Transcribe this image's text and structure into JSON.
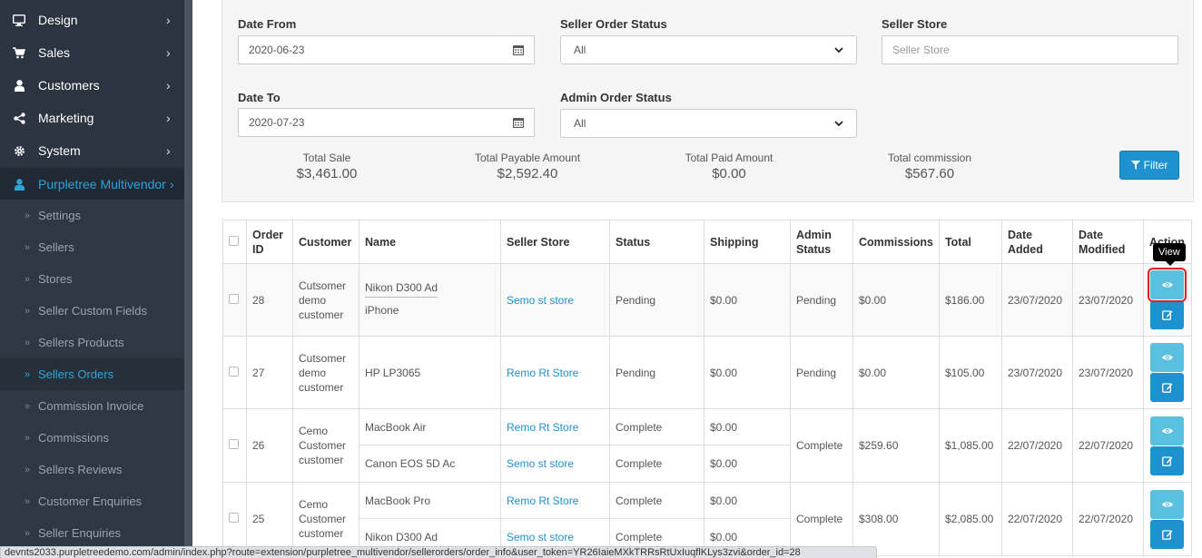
{
  "sidebar": {
    "menu": [
      {
        "label": "Design",
        "icon": "desktop-icon"
      },
      {
        "label": "Sales",
        "icon": "cart-icon"
      },
      {
        "label": "Customers",
        "icon": "user-icon"
      },
      {
        "label": "Marketing",
        "icon": "share-icon"
      },
      {
        "label": "System",
        "icon": "gear-icon"
      },
      {
        "label": "Purpletree Multivendor",
        "icon": "user-icon"
      }
    ],
    "submenu": [
      "Settings",
      "Sellers",
      "Stores",
      "Seller Custom Fields",
      "Sellers Products",
      "Sellers Orders",
      "Commission Invoice",
      "Commissions",
      "Sellers Reviews",
      "Customer Enquiries",
      "Seller Enquiries"
    ]
  },
  "filter": {
    "date_from_label": "Date From",
    "date_from_value": "2020-06-23",
    "date_to_label": "Date To",
    "date_to_value": "2020-07-23",
    "seller_status_label": "Seller Order Status",
    "seller_status_value": "All",
    "admin_status_label": "Admin Order Status",
    "admin_status_value": "All",
    "seller_store_label": "Seller Store",
    "seller_store_placeholder": "Seller Store",
    "filter_button": "Filter"
  },
  "summary": {
    "total_sale_label": "Total Sale",
    "total_sale": "$3,461.00",
    "payable_label": "Total Payable Amount",
    "payable": "$2,592.40",
    "paid_label": "Total Paid Amount",
    "paid": "$0.00",
    "commission_label": "Total commission",
    "commission": "$567.60"
  },
  "table": {
    "headers": [
      "Order ID",
      "Customer",
      "Name",
      "Seller Store",
      "Status",
      "Shipping",
      "Admin Status",
      "Commissions",
      "Total",
      "Date Added",
      "Date Modified",
      "Action"
    ],
    "rows": [
      {
        "order_id": "28",
        "customer": "Cutsomer demo customer",
        "lines": [
          {
            "name": "Nikon D300 Ad",
            "store": "Semo st store",
            "status": "Pending",
            "shipping": "$0.00"
          },
          {
            "name": "iPhone",
            "store": "",
            "status": "",
            "shipping": ""
          }
        ],
        "admin_status": "Pending",
        "commissions": "$0.00",
        "total": "$186.00",
        "date_added": "23/07/2020",
        "date_modified": "23/07/2020"
      },
      {
        "order_id": "27",
        "customer": "Cutsomer demo customer",
        "lines": [
          {
            "name": "HP LP3065",
            "store": "Remo Rt Store",
            "status": "Pending",
            "shipping": "$0.00"
          }
        ],
        "admin_status": "Pending",
        "commissions": "$0.00",
        "total": "$105.00",
        "date_added": "23/07/2020",
        "date_modified": "23/07/2020"
      },
      {
        "order_id": "26",
        "customer": "Cemo Customer customer",
        "lines": [
          {
            "name": "MacBook Air",
            "store": "Remo Rt Store",
            "status": "Complete",
            "shipping": "$0.00"
          },
          {
            "name": "Canon EOS 5D Ac",
            "store": "Semo st store",
            "status": "Complete",
            "shipping": "$0.00"
          }
        ],
        "admin_status": "Complete",
        "commissions": "$259.60",
        "total": "$1,085.00",
        "date_added": "22/07/2020",
        "date_modified": "22/07/2020"
      },
      {
        "order_id": "25",
        "customer": "Cemo Customer customer",
        "lines": [
          {
            "name": "MacBook Pro",
            "store": "Remo Rt Store",
            "status": "Complete",
            "shipping": "$0.00"
          },
          {
            "name": "Nikon D300 Ad",
            "store": "Semo st store",
            "status": "Complete",
            "shipping": "$0.00"
          }
        ],
        "admin_status": "Complete",
        "commissions": "$308.00",
        "total": "$2,085.00",
        "date_added": "22/07/2020",
        "date_modified": "22/07/2020"
      }
    ]
  },
  "tooltip": "View",
  "status_bar": "devnts2033.purpletreedemo.com/admin/index.php?route=extension/purpletree_multivendor/sellerorders/order_info&user_token=YR26IaieMXkTRRsRtUxIuqflKLys3zvi&order_id=28",
  "colors": {
    "accent": "#1e91cf",
    "view_button": "#5bc0de",
    "sidebar": "#2b3440",
    "highlight": "#e41e1e"
  }
}
